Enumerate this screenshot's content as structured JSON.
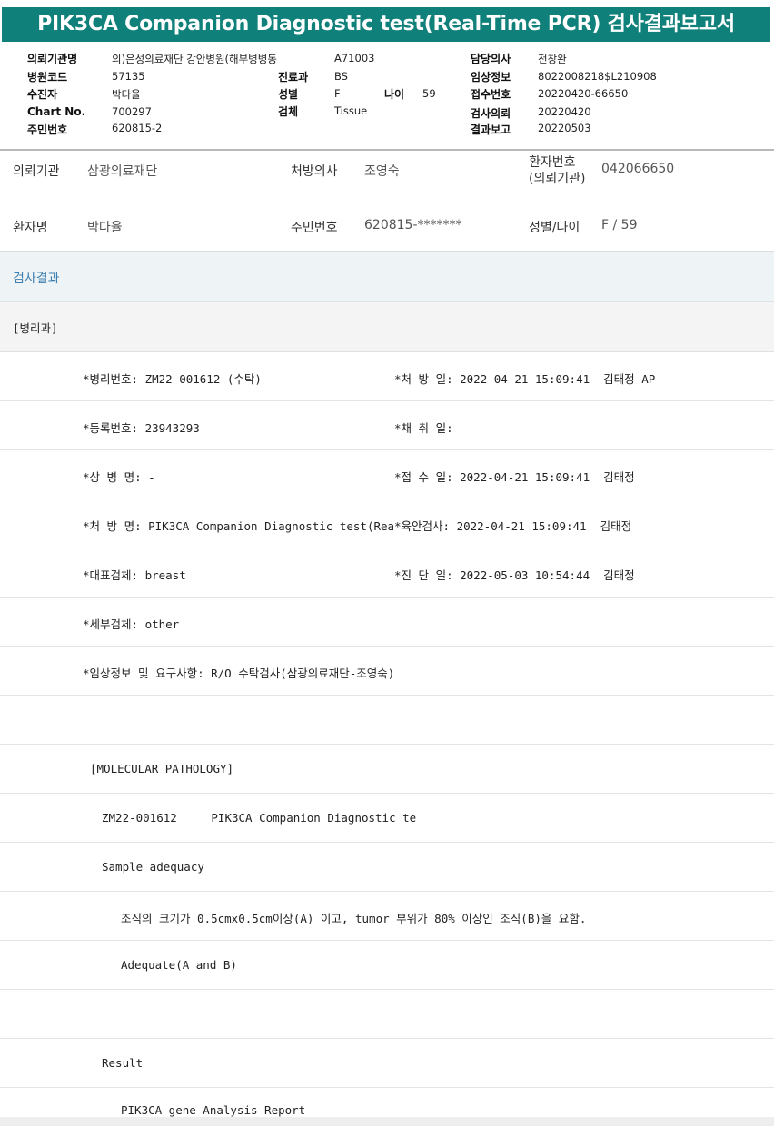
{
  "title": "PIK3CA Companion Diagnostic test(Real-Time PCR) 검사결과보고서",
  "header": {
    "referral_org_label": "의뢰기관명",
    "referral_org": "의)은성의료재단 강안병원(해부병병동",
    "ward_code": "A71003",
    "doctor_label": "담당의사",
    "doctor": "전창완",
    "hospital_code_label": "병원코드",
    "hospital_code": "57135",
    "dept_label": "진료과",
    "dept": "BS",
    "clinical_info_label": "임상정보",
    "clinical_info": "8022008218$L210908",
    "patient_label": "수진자",
    "patient": "박다율",
    "sex_label": "성별",
    "sex": "F",
    "age_label": "나이",
    "age": "59",
    "receipt_no_label": "접수번호",
    "receipt_no": "20220420-66650",
    "chart_label": "Chart No.",
    "chart": "700297",
    "specimen_label": "검체",
    "specimen": "Tissue",
    "request_date_label": "검사의뢰",
    "request_date": "20220420",
    "id_label": "주민번호",
    "id": "620815-2",
    "report_date_label": "결과보고",
    "report_date": "20220503"
  },
  "patient": {
    "org_label": "의뢰기관",
    "org": "삼광의료재단",
    "physician_label": "처방의사",
    "physician": "조영숙",
    "patient_no_label_1": "환자번호",
    "patient_no_label_2": "(의뢰기관)",
    "patient_no": "042066650",
    "name_label": "환자명",
    "name": "박다율",
    "rrn_label": "주민번호",
    "rrn": "620815-*******",
    "sexage_label": "성별/나이",
    "sexage": "F / 59"
  },
  "section": {
    "results_label": "검사결과",
    "pathology_label": "[병리과]"
  },
  "report": {
    "path_no": "*병리번호: ZM22-001612 (수탁)",
    "rx_date": "*처 방 일: 2022-04-21 15:09:41  김태정 AP",
    "reg_no": "*등록번호: 23943293",
    "collect_date": "*채 취 일:",
    "diagnosis": "*상 병 명: -",
    "receipt_date": "*접 수 일: 2022-04-21 15:09:41  김태정",
    "rx_name": "*처 방 명: PIK3CA Companion Diagnostic test(Rea",
    "gross_exam": "*육안검사: 2022-04-21 15:09:41  김태정",
    "rep_specimen": "*대표검체: breast",
    "dx_date": "*진 단 일: 2022-05-03 10:54:44  김태정",
    "sub_specimen": "*세부검체: other",
    "clinical_req": "*임상정보 및 요구사항: R/O 수탁검사(삼광의료재단-조영숙)",
    "mol_path": "[MOLECULAR PATHOLOGY]",
    "test_line": "ZM22-001612     PIK3CA Companion Diagnostic te",
    "adequacy": "Sample adequacy",
    "adequacy_desc": "조직의 크기가 0.5cmx0.5cm이상(A) 이고, tumor 부위가 80% 이상인 조직(B)을 요함.",
    "adequate": "Adequate(A and B)",
    "result": "Result",
    "report_title": "PIK3CA gene Analysis Report"
  }
}
